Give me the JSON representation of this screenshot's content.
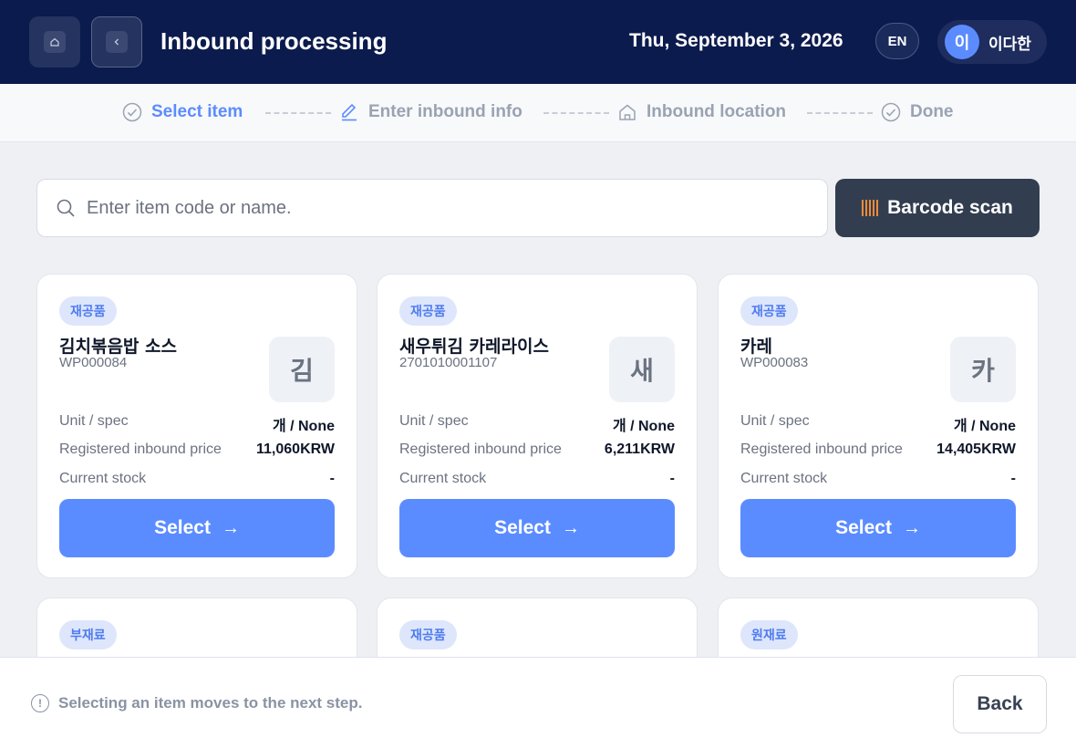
{
  "header": {
    "title": "Inbound processing",
    "date": "Thu, September 3, 2026",
    "language": "EN",
    "user": {
      "initial": "이",
      "name": "이다한"
    },
    "home_icon": "home-icon",
    "back_icon": "chevron-left-icon"
  },
  "steps": [
    {
      "label": "Select item",
      "icon": "check-circle-icon",
      "active": true
    },
    {
      "label": "Enter inbound info",
      "icon": "pencil-icon",
      "active": false
    },
    {
      "label": "Inbound location",
      "icon": "house-icon",
      "active": false
    },
    {
      "label": "Done",
      "icon": "check-circle-icon",
      "active": false
    }
  ],
  "search": {
    "placeholder": "Enter item code or name.",
    "value": ""
  },
  "scan_button": {
    "label": "Barcode scan"
  },
  "labels": {
    "unit_spec": "Unit / spec",
    "inbound_price": "Registered inbound price",
    "current_stock": "Current stock",
    "select": "Select"
  },
  "items": [
    {
      "badge": "재공품",
      "name": "김치볶음밥 소스",
      "code": "WP000084",
      "initial": "김",
      "unit_spec": "개 / None",
      "price": "11,060KRW",
      "stock": "-"
    },
    {
      "badge": "재공품",
      "name": "새우튀김 카레라이스",
      "code": "2701010001107",
      "initial": "새",
      "unit_spec": "개 / None",
      "price": "6,211KRW",
      "stock": "-"
    },
    {
      "badge": "재공품",
      "name": "카레",
      "code": "WP000083",
      "initial": "카",
      "unit_spec": "개 / None",
      "price": "14,405KRW",
      "stock": "-"
    },
    {
      "badge": "부재료"
    },
    {
      "badge": "재공품"
    },
    {
      "badge": "원재료"
    }
  ],
  "footer": {
    "hint": "Selecting an item moves to the next step.",
    "back_label": "Back"
  },
  "colors": {
    "navy": "#0c1b4d",
    "accent": "#5b8cff",
    "dark_button": "#323e4f"
  }
}
